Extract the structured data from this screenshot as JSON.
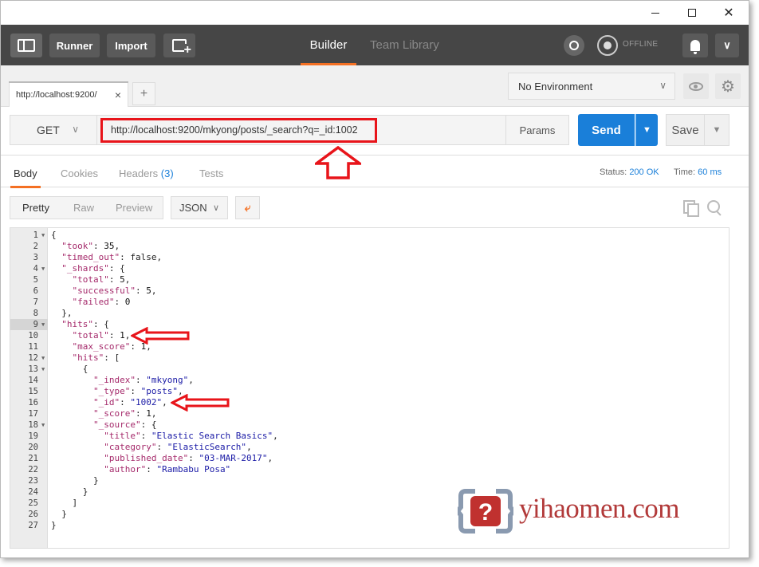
{
  "toolbar": {
    "runner": "Runner",
    "import": "Import",
    "builder": "Builder",
    "team_library": "Team Library",
    "offline": "OFFLINE"
  },
  "request_tab": {
    "label": "http://localhost:9200/"
  },
  "environment": {
    "selected": "No Environment"
  },
  "request": {
    "method": "GET",
    "url": "http://localhost:9200/mkyong/posts/_search?q=_id:1002",
    "params_label": "Params",
    "send_label": "Send",
    "save_label": "Save"
  },
  "response_tabs": {
    "body": "Body",
    "cookies": "Cookies",
    "headers": "Headers",
    "headers_count": "(3)",
    "tests": "Tests"
  },
  "status": {
    "status_label": "Status:",
    "status_value": "200 OK",
    "time_label": "Time:",
    "time_value": "60 ms"
  },
  "format": {
    "pretty": "Pretty",
    "raw": "Raw",
    "preview": "Preview",
    "json": "JSON"
  },
  "code_lines": [
    {
      "n": "1",
      "fold": true,
      "text": "{"
    },
    {
      "n": "2",
      "text": "  \"took\": 35,"
    },
    {
      "n": "3",
      "text": "  \"timed_out\": false,"
    },
    {
      "n": "4",
      "fold": true,
      "text": "  \"_shards\": {"
    },
    {
      "n": "5",
      "text": "    \"total\": 5,"
    },
    {
      "n": "6",
      "text": "    \"successful\": 5,"
    },
    {
      "n": "7",
      "text": "    \"failed\": 0"
    },
    {
      "n": "8",
      "text": "  },"
    },
    {
      "n": "9",
      "fold": true,
      "active": true,
      "text": "  \"hits\": {"
    },
    {
      "n": "10",
      "text": "    \"total\": 1,"
    },
    {
      "n": "11",
      "text": "    \"max_score\": 1,"
    },
    {
      "n": "12",
      "fold": true,
      "text": "    \"hits\": ["
    },
    {
      "n": "13",
      "fold": true,
      "text": "      {"
    },
    {
      "n": "14",
      "text": "        \"_index\": \"mkyong\","
    },
    {
      "n": "15",
      "text": "        \"_type\": \"posts\","
    },
    {
      "n": "16",
      "text": "        \"_id\": \"1002\","
    },
    {
      "n": "17",
      "text": "        \"_score\": 1,"
    },
    {
      "n": "18",
      "fold": true,
      "text": "        \"_source\": {"
    },
    {
      "n": "19",
      "text": "          \"title\": \"Elastic Search Basics\","
    },
    {
      "n": "20",
      "text": "          \"category\": \"ElasticSearch\","
    },
    {
      "n": "21",
      "text": "          \"published_date\": \"03-MAR-2017\","
    },
    {
      "n": "22",
      "text": "          \"author\": \"Rambabu Posa\""
    },
    {
      "n": "23",
      "text": "        }"
    },
    {
      "n": "24",
      "text": "      }"
    },
    {
      "n": "25",
      "text": "    ]"
    },
    {
      "n": "26",
      "text": "  }"
    },
    {
      "n": "27",
      "text": "}"
    }
  ],
  "watermark": {
    "text": "yihaomen.com"
  },
  "colors": {
    "accent": "#f47023",
    "send": "#1a7fd9",
    "annotation": "#e8141a"
  }
}
